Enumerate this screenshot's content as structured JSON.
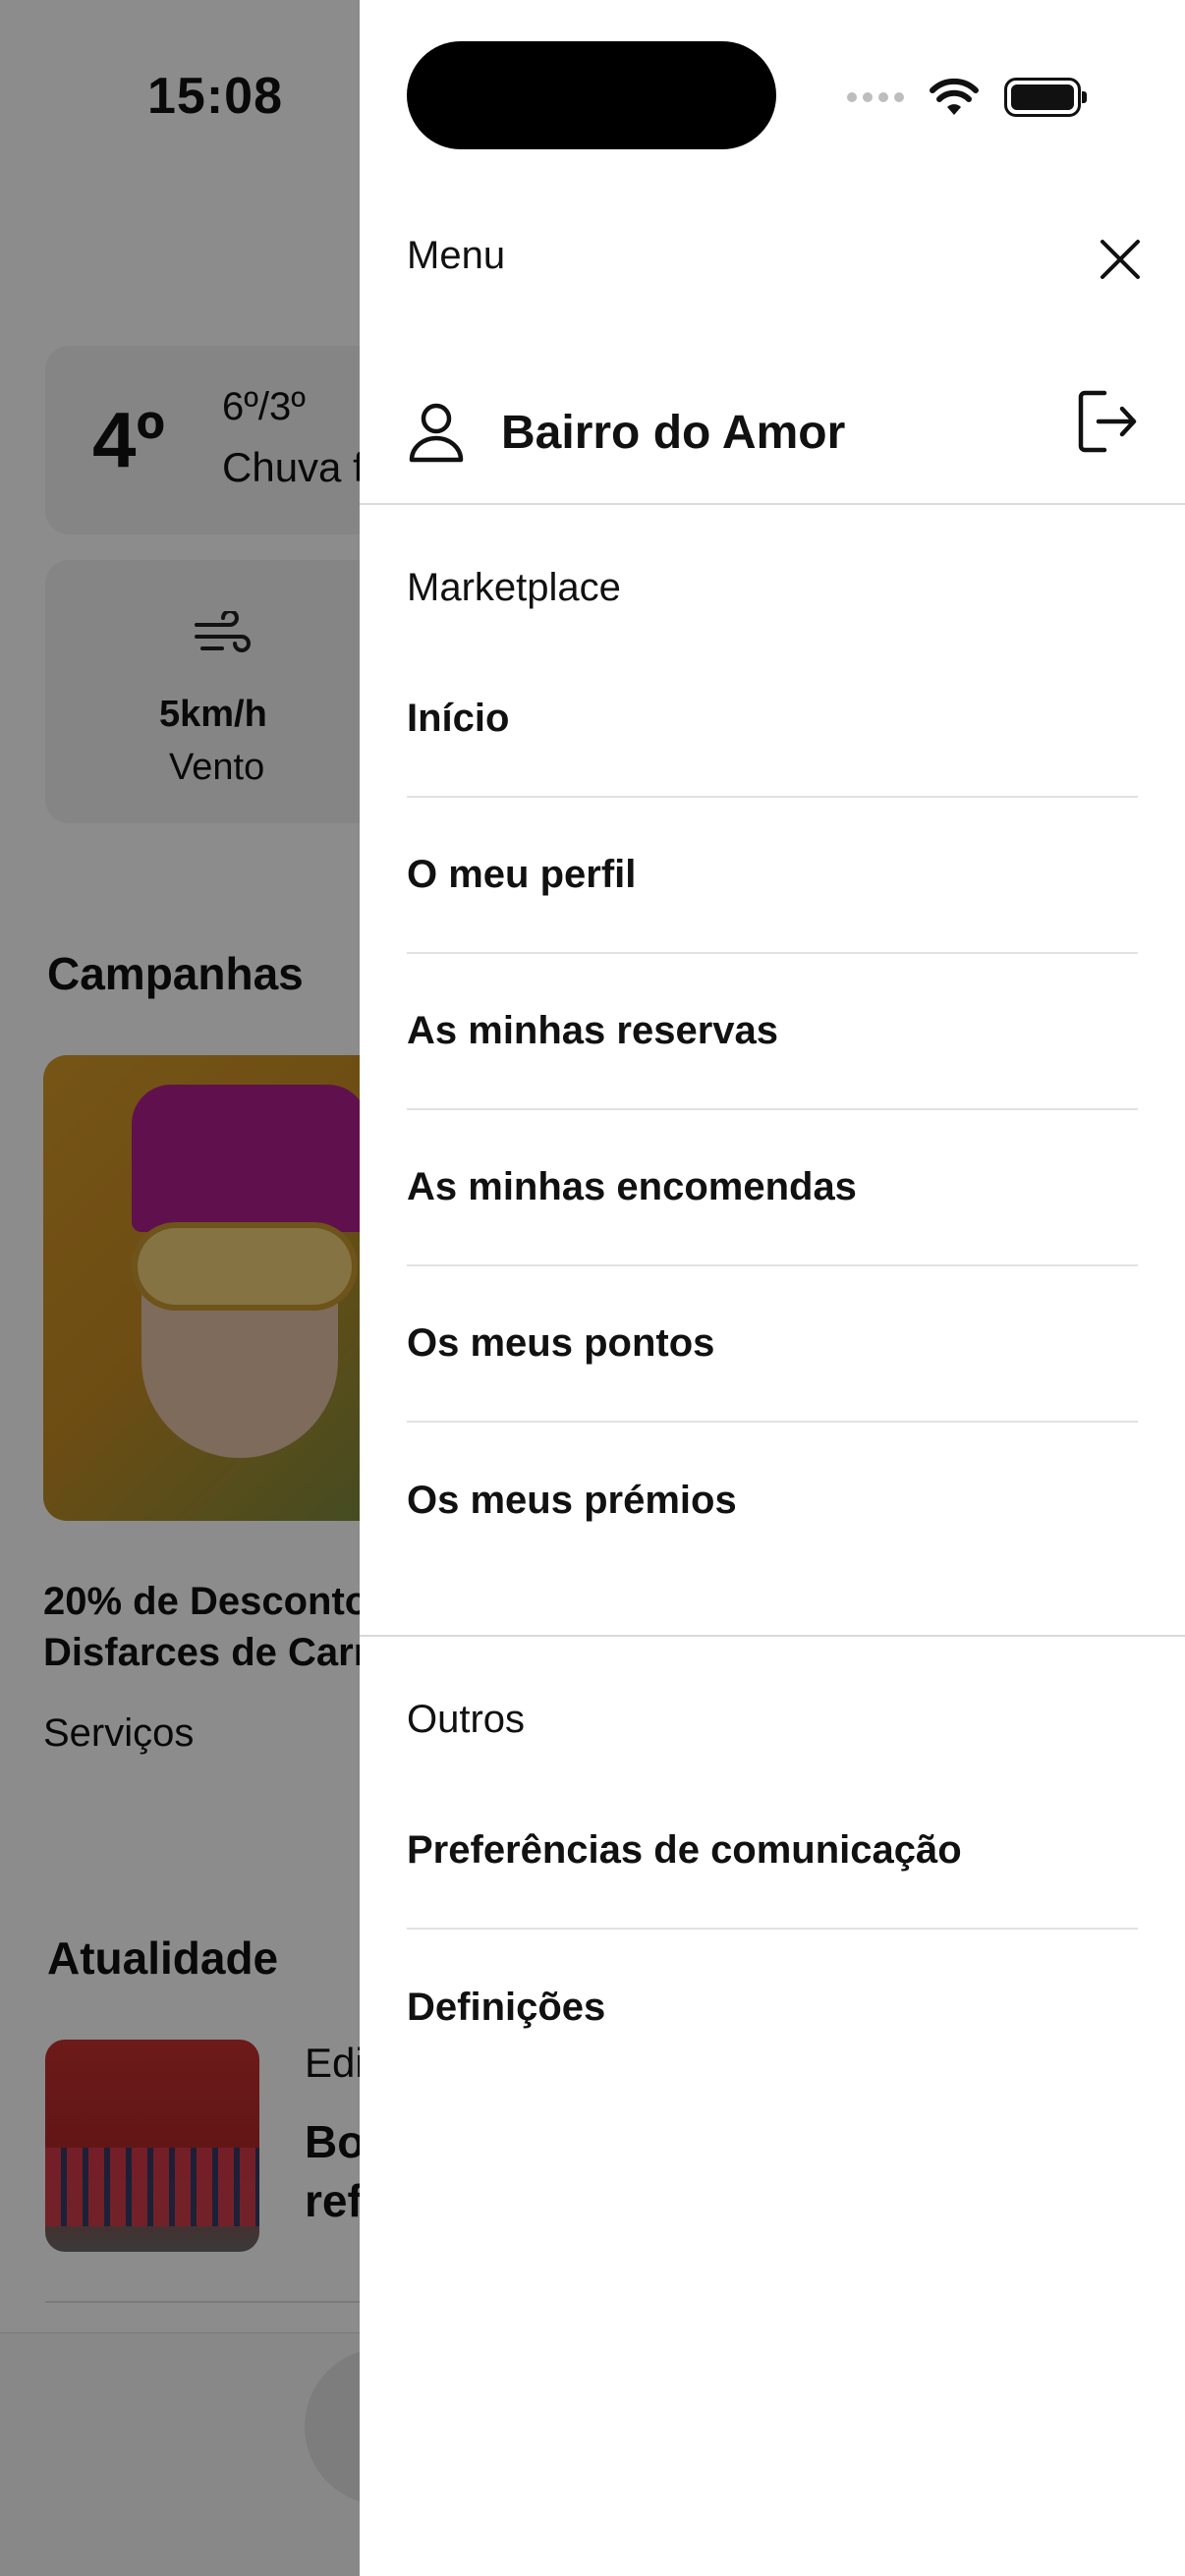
{
  "status": {
    "time": "15:08"
  },
  "background": {
    "weather": {
      "temp": "4º",
      "range": "6º/3º",
      "desc": "Chuva f"
    },
    "wind": {
      "value": "5km/h",
      "label": "Vento"
    },
    "campaigns": {
      "heading": "Campanhas",
      "title_line1": "20% de Desconto",
      "title_line2": "Disfarces de Carn",
      "category": "Serviços"
    },
    "news": {
      "heading": "Atualidade",
      "category": "Edi",
      "title_line1": "Bo",
      "title_line2": "ref"
    }
  },
  "drawer": {
    "title": "Menu",
    "user_name": "Bairro do Amor",
    "sections": [
      {
        "label": "Marketplace",
        "items": [
          "Início",
          "O meu perfil",
          "As minhas reservas",
          "As minhas encomendas",
          "Os meus pontos",
          "Os meus prémios"
        ]
      },
      {
        "label": "Outros",
        "items": [
          "Preferências de comunicação",
          "Definições"
        ]
      }
    ]
  },
  "icons": {
    "close": "close-icon",
    "user": "user-icon",
    "logout": "logout-icon",
    "wifi": "wifi-icon",
    "battery": "battery-icon",
    "wind": "wind-icon"
  }
}
